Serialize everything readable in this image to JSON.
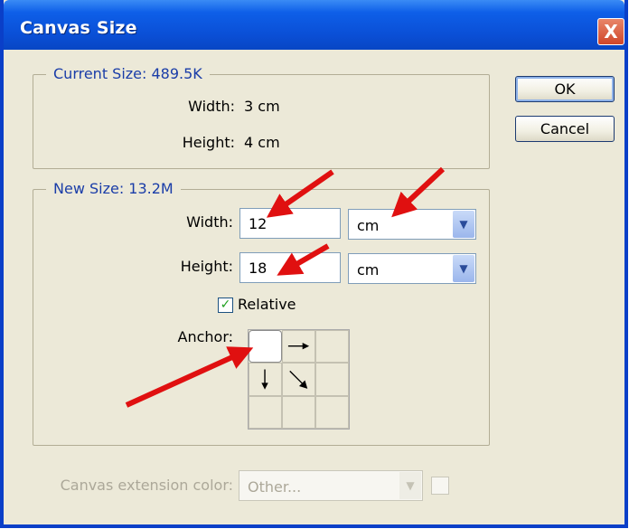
{
  "window": {
    "title": "Canvas Size",
    "close_label": "X"
  },
  "buttons": {
    "ok": "OK",
    "cancel": "Cancel"
  },
  "current_size": {
    "title": "Current Size: 489.5K",
    "width_label": "Width:",
    "width_value": "3 cm",
    "height_label": "Height:",
    "height_value": "4 cm"
  },
  "new_size": {
    "title": "New Size: 13.2M",
    "width_label": "Width:",
    "width_value": "12",
    "width_unit": "cm",
    "height_label": "Height:",
    "height_value": "18",
    "height_unit": "cm",
    "relative_label": "Relative",
    "relative_checked": true,
    "anchor_label": "Anchor:"
  },
  "extension": {
    "label": "Canvas extension color:",
    "value": "Other..."
  },
  "icons": {
    "close": "close-icon",
    "dropdown": "chevron-down-icon",
    "checkmark": "checkmark-icon",
    "arrow_right": "arrow-right-icon",
    "arrow_down": "arrow-down-icon",
    "arrow_down_right": "arrow-down-right-icon",
    "annotation": "red-arrow-icon"
  },
  "colors": {
    "title_bar": "#0a4fd6",
    "group_title": "#1a3da8",
    "annotation": "#e01010",
    "dialog_bg": "#ece9d8"
  }
}
